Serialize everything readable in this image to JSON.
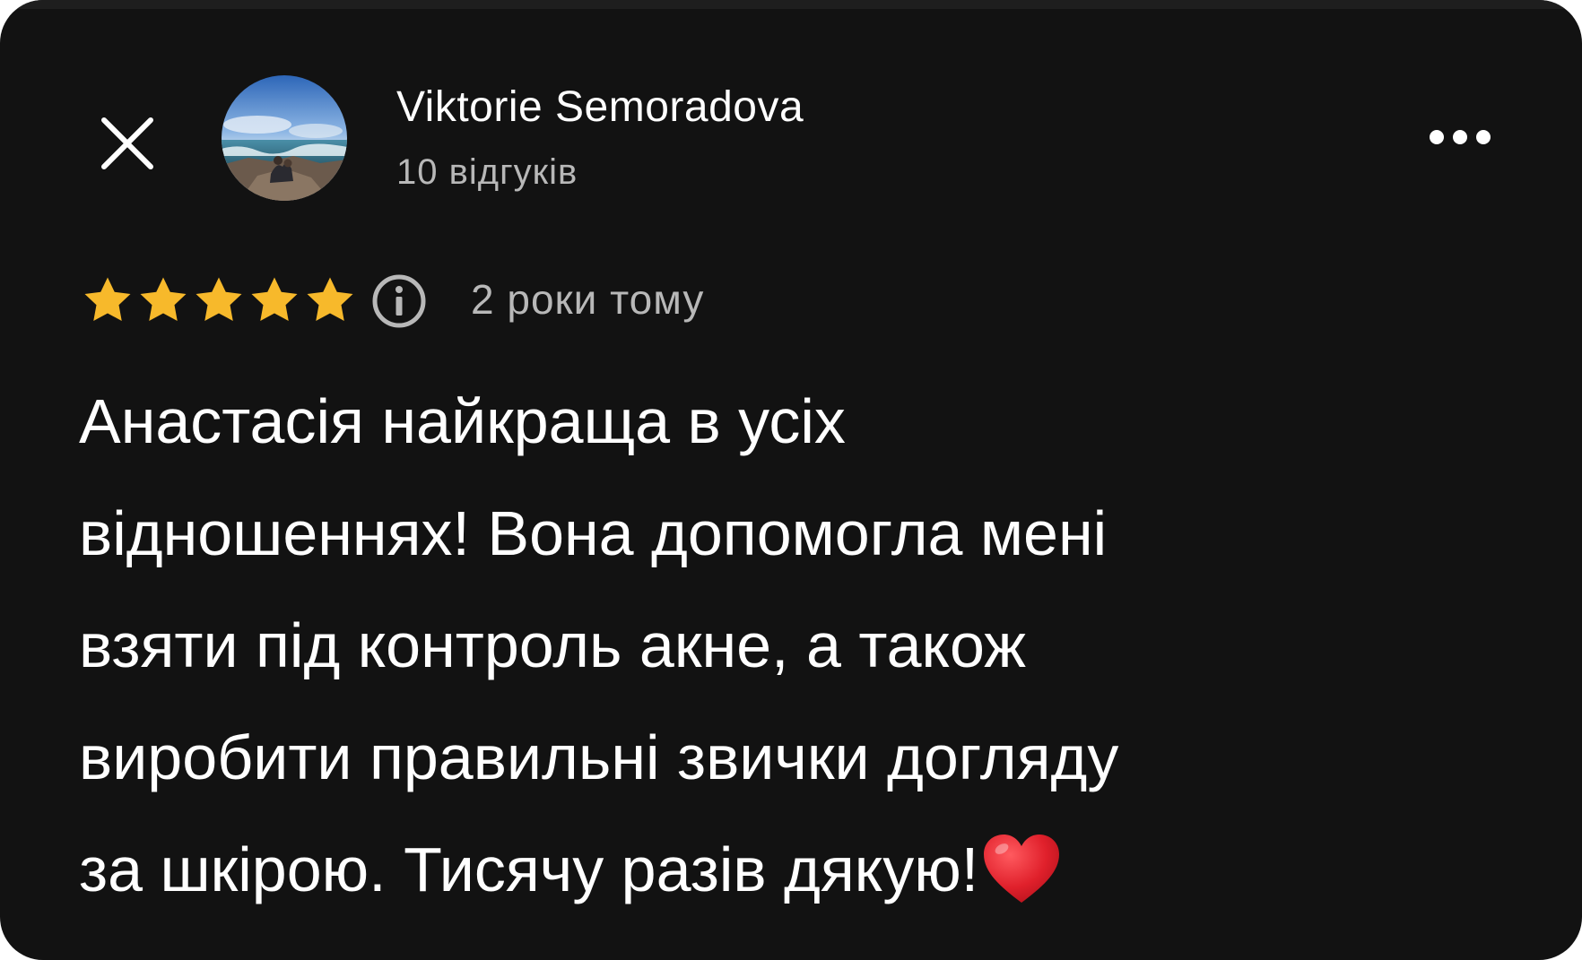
{
  "author": {
    "name": "Viktorie Semoradova",
    "review_count": "10 відгуків"
  },
  "review": {
    "rating": 5,
    "rating_max": 5,
    "time": "2 роки тому",
    "text_lines": [
      "Анастасія найкраща в усіх",
      "відношеннях! Вона допомогла мені",
      "взяти під контроль акне, а також",
      "виробити правильні звички догляду",
      "за шкірою. Тисячу разів дякую!"
    ]
  },
  "icons": {
    "close": "close-icon",
    "more": "more-horizontal-icon",
    "star": "star-icon",
    "info": "info-icon",
    "heart": "red-heart-emoji"
  },
  "colors": {
    "background": "#121212",
    "text_primary": "#ffffff",
    "text_secondary": "#b8b8b8",
    "star": "#f7b92b",
    "heart": "#e0202b"
  }
}
